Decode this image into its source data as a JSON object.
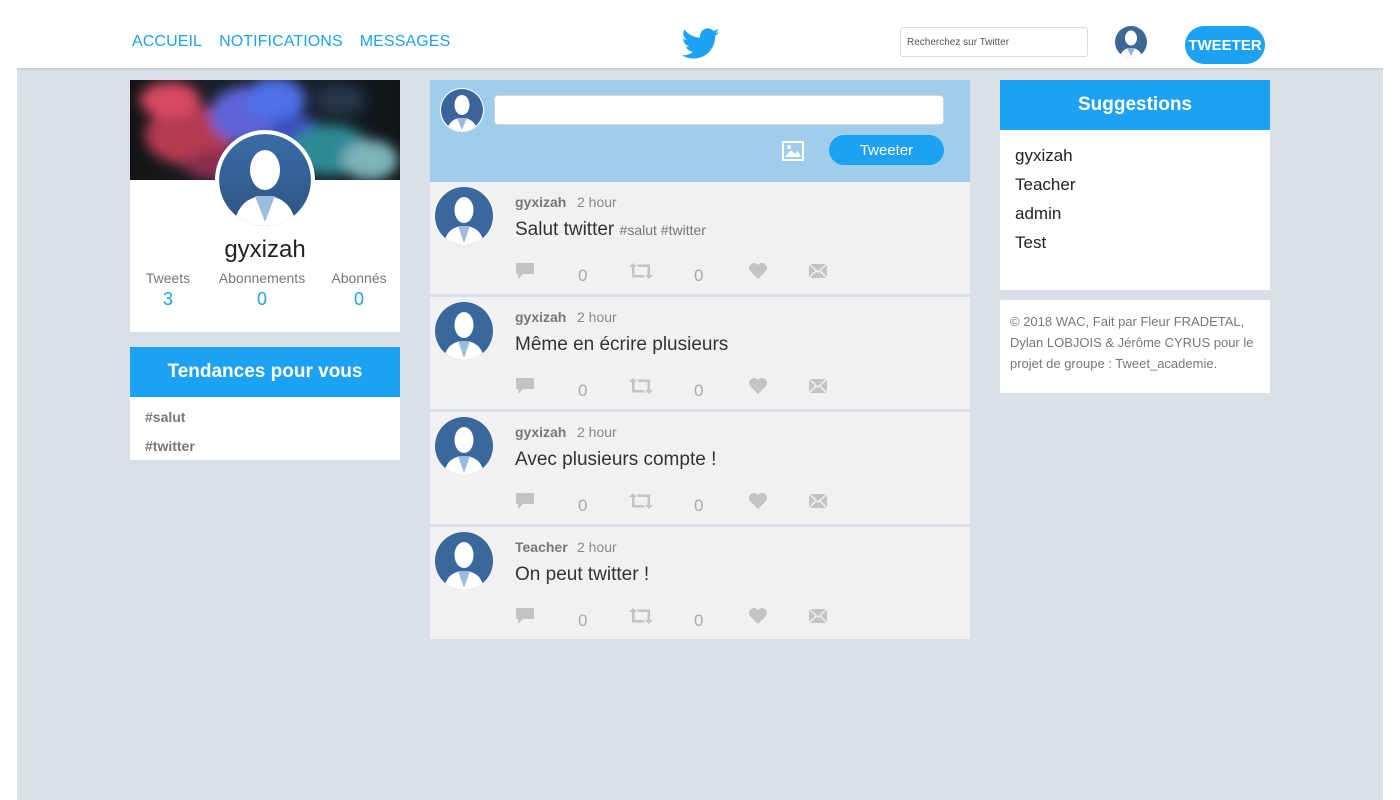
{
  "nav": {
    "home": "ACCUEIL",
    "notifications": "NOTIFICATIONS",
    "messages": "MESSAGES",
    "search_placeholder": "Recherchez sur Twitter",
    "tweet_button": "TWEETER"
  },
  "profile": {
    "name": "gyxizah",
    "stats": [
      {
        "label": "Tweets",
        "value": "3"
      },
      {
        "label": "Abonnements",
        "value": "0"
      },
      {
        "label": "Abonnés",
        "value": "0"
      }
    ]
  },
  "trends": {
    "title": "Tendances pour vous",
    "items": [
      "#salut",
      "#twitter"
    ]
  },
  "compose": {
    "button": "Tweeter"
  },
  "tweets": [
    {
      "author": "gyxizah",
      "time": "2 hour",
      "text": "Salut twitter",
      "tags": "#salut #twitter",
      "replies": "0",
      "retweets": "0"
    },
    {
      "author": "gyxizah",
      "time": "2 hour",
      "text": "Même en écrire plusieurs",
      "tags": "",
      "replies": "0",
      "retweets": "0"
    },
    {
      "author": "gyxizah",
      "time": "2 hour",
      "text": "Avec plusieurs compte !",
      "tags": "",
      "replies": "0",
      "retweets": "0"
    },
    {
      "author": "Teacher",
      "time": "2 hour",
      "text": "On peut twitter !",
      "tags": "",
      "replies": "0",
      "retweets": "0"
    }
  ],
  "suggestions": {
    "title": "Suggestions",
    "items": [
      "gyxizah",
      "Teacher",
      "admin",
      "Test"
    ]
  },
  "footer": {
    "text": "© 2018 WAC, Fait par Fleur FRADETAL, Dylan LOBJOIS & Jérôme CYRUS pour le projet de groupe : Tweet_academie."
  },
  "colors": {
    "accent": "#1da1f2",
    "background": "#d9e0e7",
    "compose_bg": "#a1cdec",
    "tweet_bg": "#f1f1f1"
  },
  "icons": [
    "twitter-bird-icon",
    "avatar-icon",
    "image-icon",
    "reply-icon",
    "retweet-icon",
    "like-icon",
    "message-icon"
  ]
}
